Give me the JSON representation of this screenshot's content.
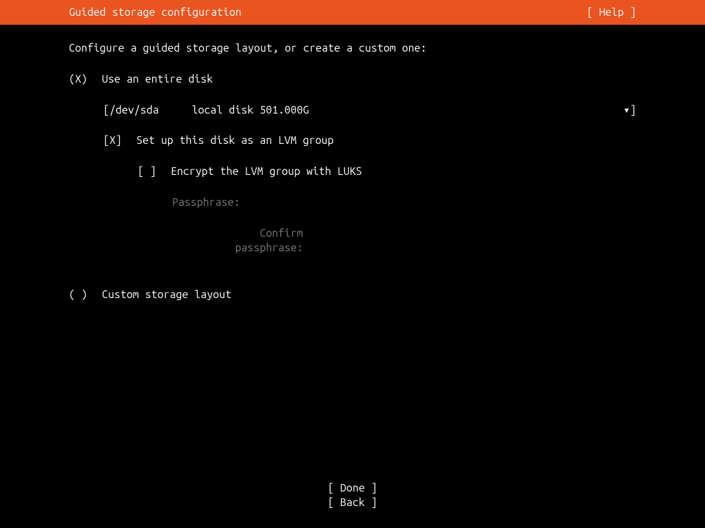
{
  "header": {
    "title": "Guided storage configuration",
    "help": "[ Help ]"
  },
  "instruction": "Configure a guided storage layout, or create a custom one:",
  "options": {
    "entire_disk": {
      "mark": "(X)",
      "label": "Use an entire disk"
    },
    "disk_select": {
      "open_bracket": "[ ",
      "device": "/dev/sda",
      "desc": "local disk 501.000G",
      "dropdown": "▾",
      "close_bracket": " ]"
    },
    "lvm": {
      "mark": "[X]",
      "label": "Set up this disk as an LVM group"
    },
    "luks": {
      "mark": "[ ]",
      "label": "Encrypt the LVM group with LUKS"
    },
    "passphrase_label": "Passphrase:",
    "confirm_label": "Confirm passphrase:",
    "custom": {
      "mark": "( )",
      "label": "Custom storage layout"
    }
  },
  "footer": {
    "done": "[ Done       ]",
    "back": "[ Back       ]"
  }
}
